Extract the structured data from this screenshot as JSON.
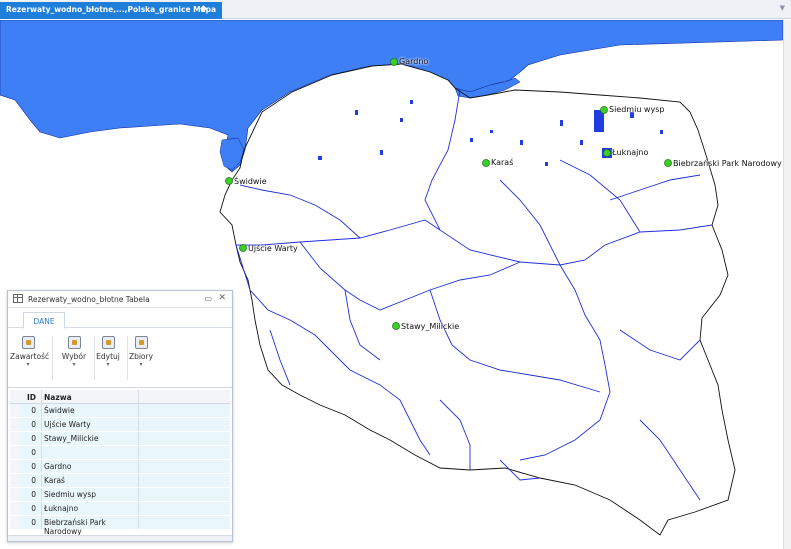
{
  "tab": {
    "title": "Rezerwaty_wodno_błotne,...,Polska_granice Mapa"
  },
  "map": {
    "water_color": "#3f7ff5",
    "river_color": "#1f2fd8",
    "point_color": "#3ccf2a",
    "sites": [
      {
        "id": "gardno",
        "label": "Gardno"
      },
      {
        "id": "siedmiu",
        "label": "Siedmiu wysp"
      },
      {
        "id": "karas",
        "label": "Karaś"
      },
      {
        "id": "luknajno",
        "label": "Łuknajno"
      },
      {
        "id": "biebrza",
        "label": "Biebrzański Park Narodowy"
      },
      {
        "id": "swidwie",
        "label": "Świdwie"
      },
      {
        "id": "warta",
        "label": "Ujście Warty"
      },
      {
        "id": "milickie",
        "label": "Stawy_Milickie"
      }
    ]
  },
  "table_window": {
    "title": "Rezerwaty_wodno_błotne Tabela",
    "ribbon_tab": "DANE",
    "buttons": [
      {
        "label": "Zawartość",
        "icon": "contents-icon"
      },
      {
        "label": "Wybór",
        "icon": "selection-icon"
      },
      {
        "label": "Edytuj",
        "icon": "edit-icon"
      },
      {
        "label": "Zbiory",
        "icon": "sets-icon"
      }
    ],
    "columns": {
      "id": "ID",
      "name": "Nazwa"
    },
    "rows": [
      {
        "id": "0",
        "name": "Świdwie"
      },
      {
        "id": "0",
        "name": "Ujście Warty"
      },
      {
        "id": "0",
        "name": "Stawy_Milickie"
      },
      {
        "id": "0",
        "name": ""
      },
      {
        "id": "0",
        "name": "Gardno"
      },
      {
        "id": "0",
        "name": "Karaś"
      },
      {
        "id": "0",
        "name": "Siedmiu wysp"
      },
      {
        "id": "0",
        "name": "Łuknajno"
      },
      {
        "id": "0",
        "name": "Biebrzański Park Narodowy"
      }
    ]
  }
}
